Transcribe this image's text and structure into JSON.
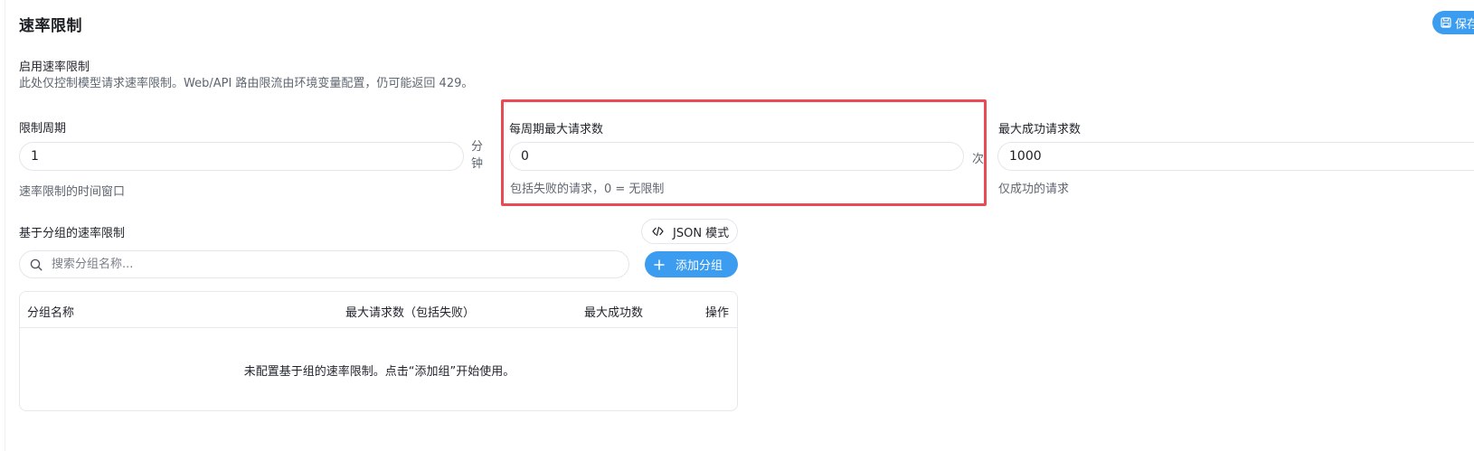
{
  "page": {
    "title": "速率限制",
    "save_label": "保存",
    "enable_label": "启用速率限制",
    "enable_desc": "此处仅控制模型请求速率限制。Web/API 路由限流由环境变量配置，仍可能返回 429。"
  },
  "fields": {
    "period": {
      "label": "限制周期",
      "value": "1",
      "unit": [
        "分",
        "钟"
      ],
      "hint": "速率限制的时间窗口"
    },
    "max_requests": {
      "label": "每周期最大请求数",
      "value": "0",
      "unit": "次",
      "hint": "包括失败的请求，0 = 无限制"
    },
    "max_success": {
      "label": "最大成功请求数",
      "value": "1000",
      "hint": "仅成功的请求"
    }
  },
  "groups": {
    "label": "基于分组的速率限制",
    "json_mode_label": "JSON 模式",
    "search_placeholder": "搜索分组名称...",
    "add_label": "添加分组",
    "table": {
      "columns": [
        "分组名称",
        "最大请求数（包括失败）",
        "最大成功数",
        "操作"
      ],
      "rows": [],
      "empty_text": "未配置基于组的速率限制。点击“添加组”开始使用。"
    }
  },
  "colors": {
    "accent": "#3b9cf0",
    "highlight": "#e94b55",
    "border": "#e3e6ea"
  },
  "icons": {
    "save": "save-icon",
    "code": "code-icon",
    "search": "search-icon",
    "plus": "plus-icon"
  }
}
